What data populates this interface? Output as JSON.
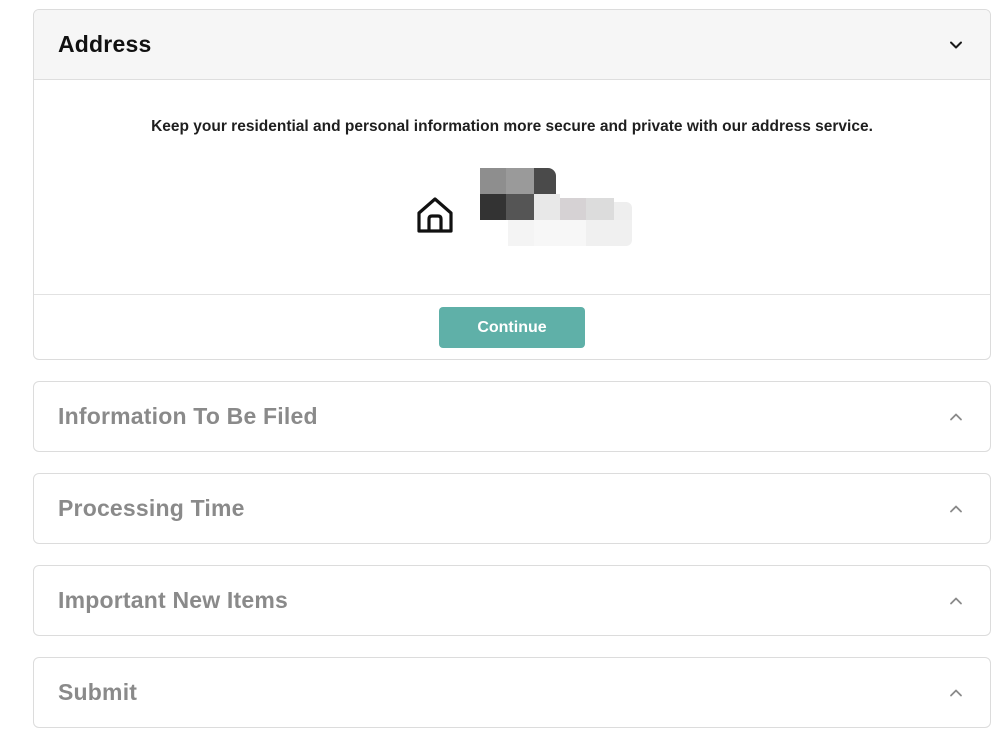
{
  "address_panel": {
    "title": "Address",
    "intro": "Keep your residential and personal information more secure and private with our address service.",
    "home_icon": "home-icon",
    "toggle_icon": "chevron-down-icon",
    "continue_label": "Continue",
    "accent_color": "#5fb0a8"
  },
  "collapsed_panels": [
    {
      "title": "Information To Be Filed",
      "toggle_icon": "chevron-up-icon"
    },
    {
      "title": "Processing Time",
      "toggle_icon": "chevron-up-icon"
    },
    {
      "title": "Important New Items",
      "toggle_icon": "chevron-up-icon"
    },
    {
      "title": "Submit",
      "toggle_icon": "chevron-up-icon"
    }
  ]
}
